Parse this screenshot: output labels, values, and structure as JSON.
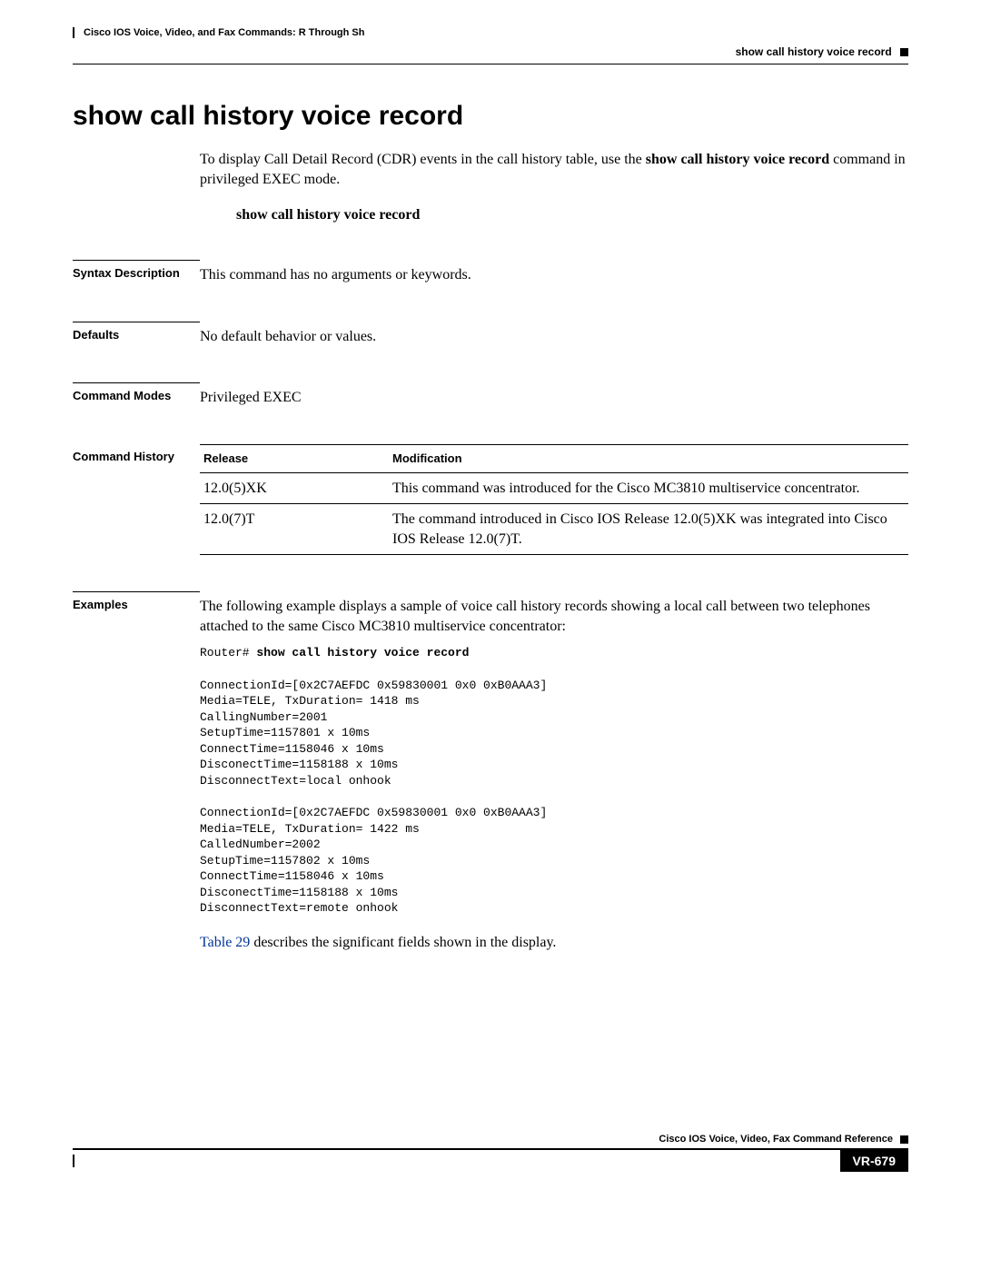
{
  "header": {
    "breadcrumb": "Cisco IOS Voice, Video, and Fax Commands: R Through Sh",
    "right": "show call history voice record"
  },
  "title": "show call history voice record",
  "intro": {
    "before_bold": "To display Call Detail Record (CDR) events in the call history table, use the ",
    "bold": "show call history voice record",
    "after_bold": " command in privileged EXEC mode."
  },
  "syntax_line": "show call history voice record",
  "sections": {
    "syntax_description": {
      "label": "Syntax Description",
      "text": "This command has no arguments or keywords."
    },
    "defaults": {
      "label": "Defaults",
      "text": "No default behavior or values."
    },
    "command_modes": {
      "label": "Command Modes",
      "text": "Privileged EXEC"
    },
    "command_history": {
      "label": "Command History",
      "columns": {
        "release": "Release",
        "modification": "Modification"
      },
      "rows": [
        {
          "release": "12.0(5)XK",
          "modification": "This command was introduced for the Cisco MC3810 multiservice concentrator."
        },
        {
          "release": "12.0(7)T",
          "modification": "The command introduced in Cisco IOS Release 12.0(5)XK was integrated into Cisco IOS Release 12.0(7)T."
        }
      ]
    },
    "examples": {
      "label": "Examples",
      "intro": "The following example displays a sample of voice call history records showing a local call between two telephones attached to the same Cisco MC3810 multiservice concentrator:",
      "prompt": "Router# ",
      "command": "show call history voice record",
      "output1": "ConnectionId=[0x2C7AEFDC 0x59830001 0x0 0xB0AAA3]\nMedia=TELE, TxDuration= 1418 ms\nCallingNumber=2001\nSetupTime=1157801 x 10ms\nConnectTime=1158046 x 10ms\nDisconectTime=1158188 x 10ms\nDisconnectText=local onhook",
      "output2": "ConnectionId=[0x2C7AEFDC 0x59830001 0x0 0xB0AAA3]\nMedia=TELE, TxDuration= 1422 ms\nCalledNumber=2002\nSetupTime=1157802 x 10ms\nConnectTime=1158046 x 10ms\nDisconectTime=1158188 x 10ms\nDisconnectText=remote onhook",
      "table_ref": "Table 29",
      "table_ref_after": " describes the significant fields shown in the display."
    }
  },
  "footer": {
    "ref": "Cisco IOS Voice, Video, Fax Command Reference",
    "page": "VR-679"
  }
}
